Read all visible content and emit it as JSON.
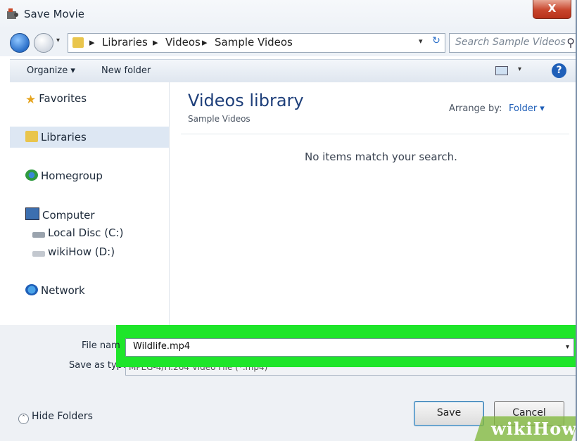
{
  "window": {
    "title": "Save Movie",
    "close_label": "X"
  },
  "address": {
    "crumbs": [
      "Libraries",
      "Videos",
      "Sample Videos"
    ],
    "separator": "▸",
    "search_placeholder": "Search Sample Videos"
  },
  "toolbar": {
    "organize": "Organize ▾",
    "new_folder": "New folder",
    "help": "?"
  },
  "nav": {
    "favorites": "Favorites",
    "libraries": "Libraries",
    "homegroup": "Homegroup",
    "computer": "Computer",
    "local_disc": "Local Disc (C:)",
    "wikihow": "wikiHow (D:)",
    "network": "Network"
  },
  "content": {
    "title": "Videos library",
    "subtitle": "Sample Videos",
    "arrange_label": "Arrange by:",
    "arrange_value": "Folder ▾",
    "empty_message": "No items match your search."
  },
  "form": {
    "file_name_label": "File nam",
    "file_name_value": "Wildlife.mp4",
    "save_type_label": "Save as type:",
    "save_type_value": "MPEG-4/H.264 Video File (*.mp4)"
  },
  "footer": {
    "hide_folders": "Hide Folders",
    "save": "Save",
    "cancel": "Cancel"
  },
  "watermark": "wikiHow",
  "colors": {
    "highlight": "#1ee52a",
    "title_blue": "#1e3f7a",
    "link_blue": "#1f5fb8",
    "watermark": "#82b93c"
  }
}
